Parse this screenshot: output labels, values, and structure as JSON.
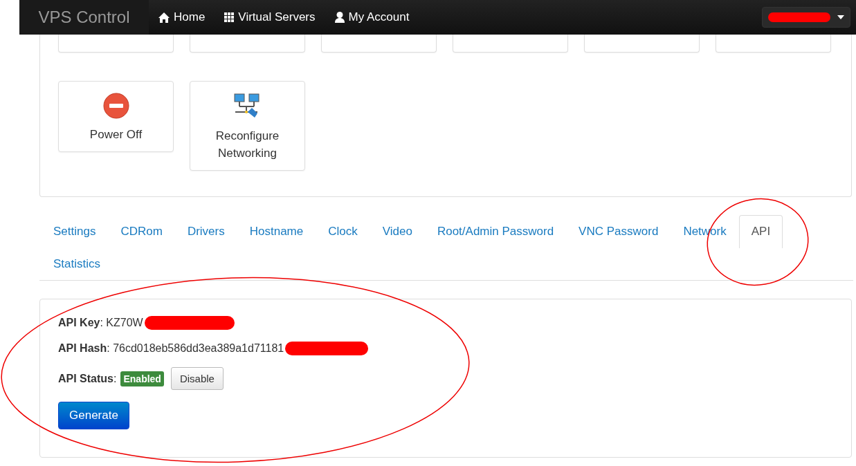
{
  "navbar": {
    "brand": "VPS Control",
    "links": [
      {
        "label": "Home",
        "kind": "home"
      },
      {
        "label": "Virtual Servers",
        "kind": "grid"
      },
      {
        "label": "My Account",
        "kind": "user"
      }
    ],
    "user_menu": {
      "redacted": true
    }
  },
  "actions": {
    "cut_row": [
      {
        "kind": "card"
      },
      {
        "kind": "card"
      },
      {
        "kind": "card"
      },
      {
        "kind": "card"
      },
      {
        "kind": "card"
      },
      {
        "kind": "card"
      }
    ],
    "row": [
      {
        "label": "Power Off",
        "kind": "stop"
      },
      {
        "label": "Reconfigure Networking",
        "kind": "network"
      }
    ]
  },
  "tabs": [
    {
      "label": "Settings",
      "selected": false
    },
    {
      "label": "CDRom",
      "selected": false
    },
    {
      "label": "Drivers",
      "selected": false
    },
    {
      "label": "Hostname",
      "selected": false
    },
    {
      "label": "Clock",
      "selected": false
    },
    {
      "label": "Video",
      "selected": false
    },
    {
      "label": "Root/Admin Password",
      "selected": false
    },
    {
      "label": "VNC Password",
      "selected": false
    },
    {
      "label": "Network",
      "selected": false
    },
    {
      "label": "API",
      "selected": true
    },
    {
      "label": "Statistics",
      "selected": false
    }
  ],
  "api": {
    "key_line": "**API Key**: KZ70W",
    "hash_line": "**API Hash**: 76cd018eb586dd3ea389a1d71181",
    "status_label": "**API Status**:",
    "status": "Enabled",
    "enabled": true,
    "toggle_button": "Disable",
    "generate_button": "Generate"
  }
}
